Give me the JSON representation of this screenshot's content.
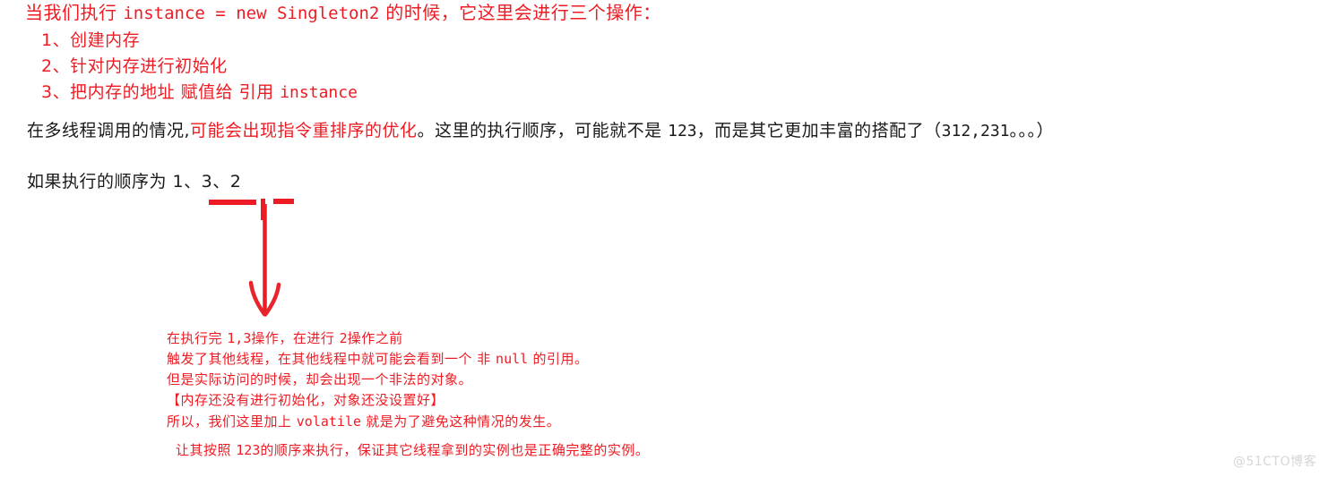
{
  "intro": {
    "prefix": "当我们执行 ",
    "code": "instance = new Singleton2",
    "suffix": " 的时候，它这里会进行三个操作："
  },
  "steps": [
    {
      "text": "1、创建内存"
    },
    {
      "text": "2、针对内存进行初始化"
    },
    {
      "prefix": "3、把内存的地址 赋值给 引用 ",
      "code": "instance"
    }
  ],
  "reorder_paragraph": {
    "part1": "在多线程调用的情况,",
    "part2_red": "可能会出现指令重排序的优化",
    "part3": "。这里的执行顺序，可能就不是 ",
    "part4_code": "123",
    "part5": "，而是其它更加丰富的搭配了（",
    "part6_code": "312,231",
    "part7": "。。。）"
  },
  "order_paragraph": {
    "prefix": "如果执行的顺序为 ",
    "sequence": "1、3、2"
  },
  "annotation_marks": {
    "underline_13_label": "underline under 1、3",
    "tick_label": "separator tick",
    "underline_2_label": "underline under 2",
    "arrow_label": "downward arrow"
  },
  "explanation": {
    "line1": {
      "prefix": "在执行完 ",
      "code1": "1,3",
      "mid": "操作，在进行 ",
      "code2": "2",
      "suffix": "操作之前"
    },
    "line2": {
      "prefix": "触发了其他线程，在其他线程中就可能会看到一个 非 ",
      "code": "null",
      "suffix": " 的引用。"
    },
    "line3": {
      "text": "但是实际访问的时候，却会出现一个非法的对象。"
    },
    "line4": {
      "text": "【内存还没有进行初始化，对象还没设置好】"
    },
    "line5": {
      "prefix": "所以，我们这里加上 ",
      "code": "volatile",
      "suffix": " 就是为了避免这种情况的发生。"
    },
    "line6": {
      "prefix": "让其按照 ",
      "code": "123",
      "suffix": "的顺序来执行，保证其它线程拿到的实例也是正确完整的实例。"
    }
  },
  "watermark": {
    "text": "@51CTO博客"
  },
  "colors": {
    "red": "#ed1c24",
    "black": "#1a1a1a",
    "background": "#ffffff",
    "watermark": "#d6d6d6"
  }
}
